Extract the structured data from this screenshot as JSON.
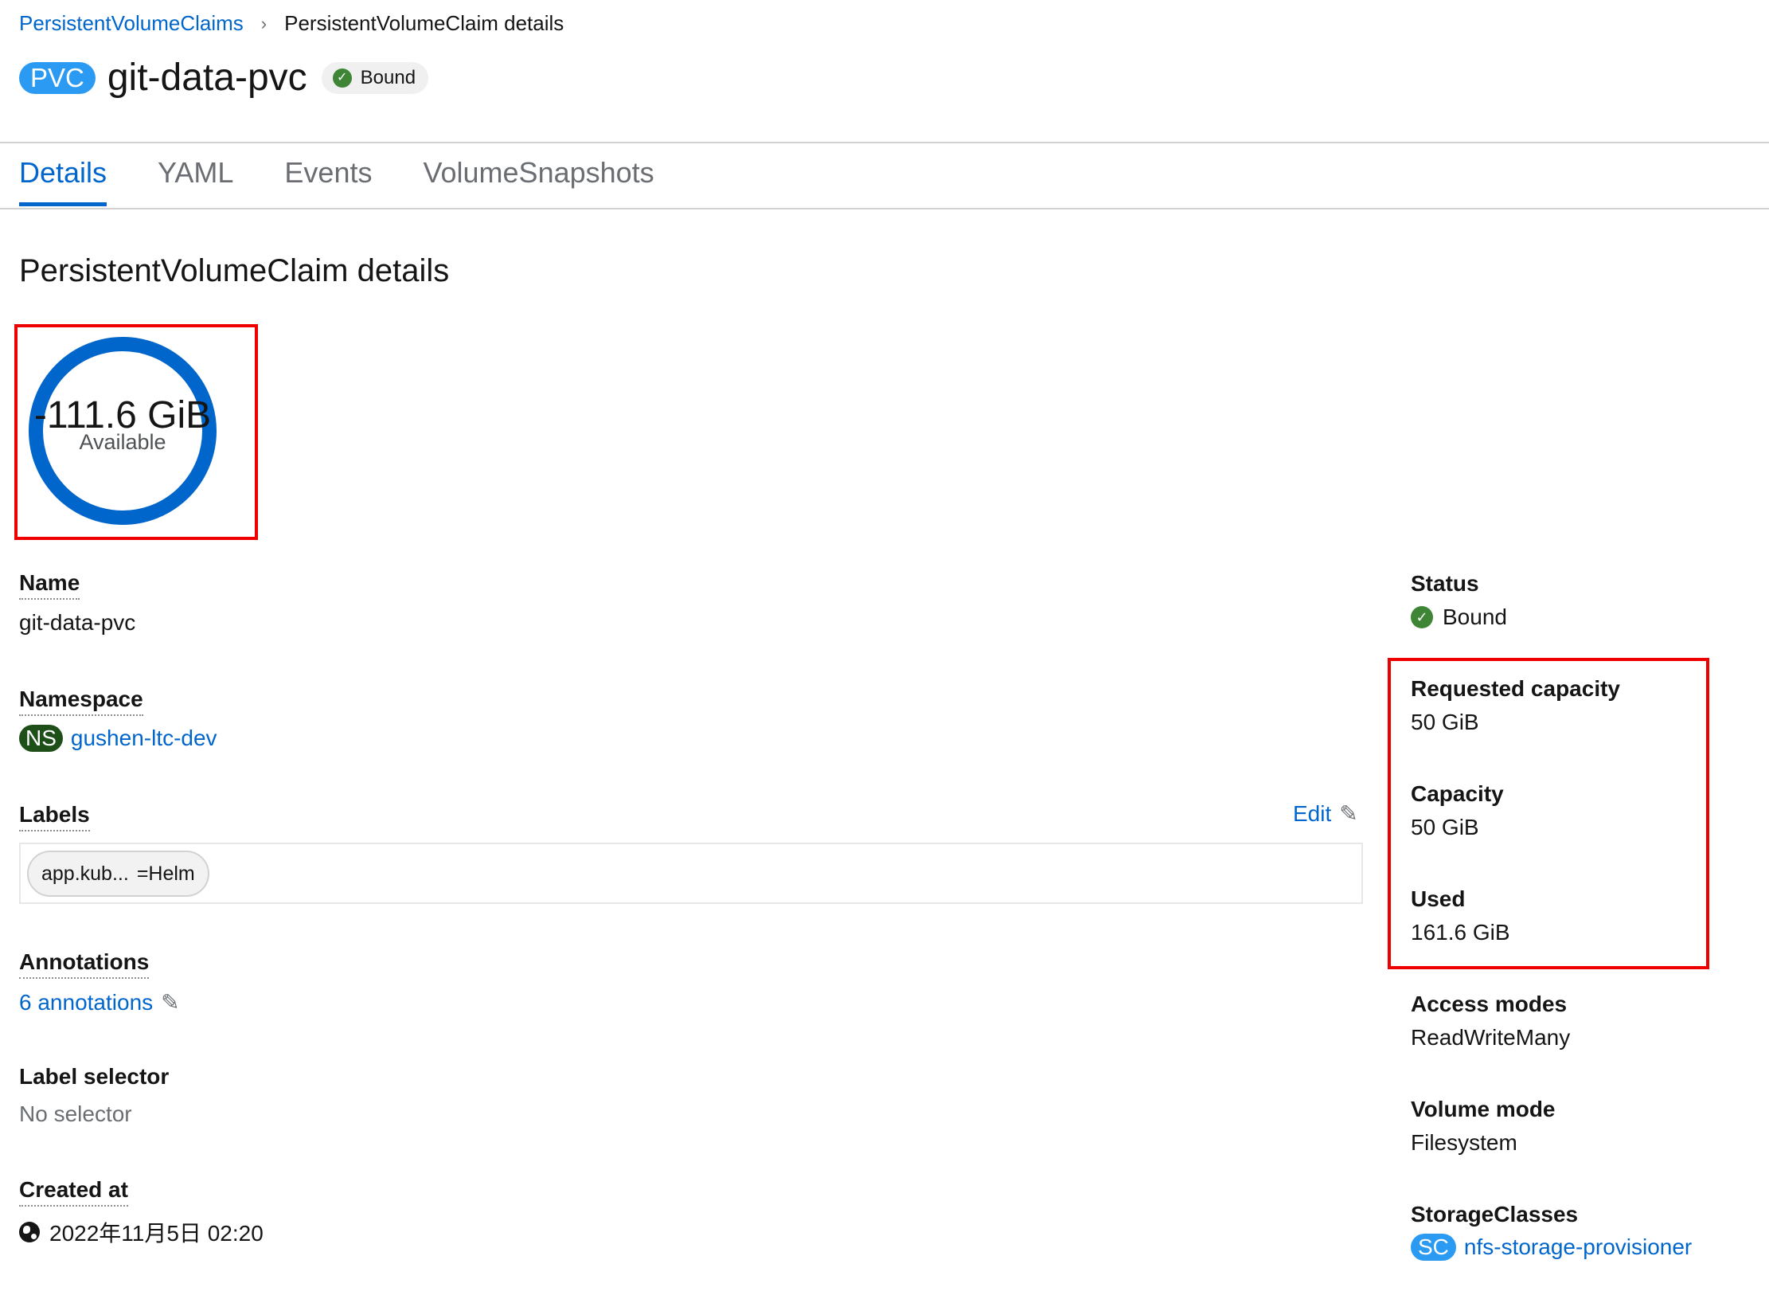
{
  "breadcrumb": {
    "parent": "PersistentVolumeClaims",
    "separator": "›",
    "current": "PersistentVolumeClaim details"
  },
  "header": {
    "resource_badge": "PVC",
    "title": "git-data-pvc",
    "status": "Bound",
    "status_icon": "check-circle-icon",
    "status_color": "#3e8635"
  },
  "tabs": [
    {
      "label": "Details",
      "active": true
    },
    {
      "label": "YAML",
      "active": false
    },
    {
      "label": "Events",
      "active": false
    },
    {
      "label": "VolumeSnapshots",
      "active": false
    }
  ],
  "section_title": "PersistentVolumeClaim details",
  "donut": {
    "value": "-111.6 GiB",
    "label": "Available",
    "ring_color": "#0066cc"
  },
  "details": {
    "name": {
      "label": "Name",
      "value": "git-data-pvc"
    },
    "namespace": {
      "label": "Namespace",
      "badge": "NS",
      "value": "gushen-ltc-dev"
    },
    "labels": {
      "label": "Labels",
      "edit": "Edit",
      "chip_key": "app.kub...",
      "chip_value": "=Helm"
    },
    "annotations": {
      "label": "Annotations",
      "value": "6 annotations"
    },
    "label_selector": {
      "label": "Label selector",
      "value": "No selector"
    },
    "created_at": {
      "label": "Created at",
      "value": "2022年11月5日 02:20"
    }
  },
  "side": {
    "status": {
      "label": "Status",
      "value": "Bound"
    },
    "requested_capacity": {
      "label": "Requested capacity",
      "value": "50 GiB"
    },
    "capacity": {
      "label": "Capacity",
      "value": "50 GiB"
    },
    "used": {
      "label": "Used",
      "value": "161.6 GiB"
    },
    "access_modes": {
      "label": "Access modes",
      "value": "ReadWriteMany"
    },
    "volume_mode": {
      "label": "Volume mode",
      "value": "Filesystem"
    },
    "storage_classes": {
      "label": "StorageClasses",
      "badge": "SC",
      "value": "nfs-storage-provisioner"
    }
  },
  "colors": {
    "link": "#0066cc",
    "highlight_border": "#ee0000",
    "namespace_badge": "#1e4f18",
    "resource_badge": "#2b9af3"
  }
}
